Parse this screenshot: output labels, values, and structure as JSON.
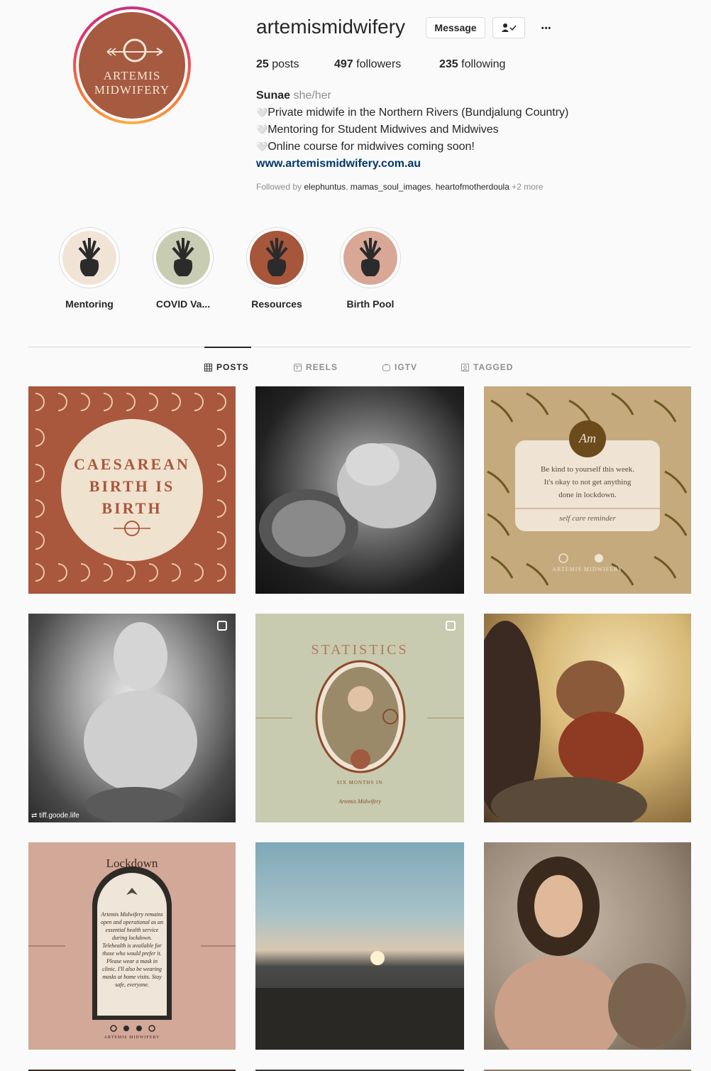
{
  "profile": {
    "username": "artemismidwifery",
    "avatar_line1": "ARTEMIS",
    "avatar_line2": "MIDWIFERY",
    "message_label": "Message",
    "more_label": "•••"
  },
  "stats": {
    "posts_count": "25",
    "posts_label": " posts",
    "followers_count": "497",
    "followers_label": " followers",
    "following_count": "235",
    "following_label": " following"
  },
  "bio": {
    "name": "Sunae",
    "pronouns": "she/her",
    "lines": [
      "Private midwife in the Northern Rivers (Bundjalung Country)",
      "Mentoring for Student Midwives and Midwives",
      "Online course for midwives coming soon!"
    ],
    "bullet": "🤍",
    "website": "www.artemismidwifery.com.au",
    "followed_by_label": "Followed by",
    "followed_users": [
      "elephuntus",
      "mamas_soul_images",
      "heartofmotherdoula"
    ],
    "followed_more": "+2 more"
  },
  "highlights": [
    {
      "label": "Mentoring",
      "bg": "#f1e4d7"
    },
    {
      "label": "COVID Va...",
      "bg": "#c8ccb2"
    },
    {
      "label": "Resources",
      "bg": "#a6563a"
    },
    {
      "label": "Birth Pool",
      "bg": "#d9a796"
    }
  ],
  "tabs": [
    {
      "label": "POSTS",
      "icon": "grid-icon"
    },
    {
      "label": "REELS",
      "icon": "reels-icon"
    },
    {
      "label": "IGTV",
      "icon": "igtv-icon"
    },
    {
      "label": "TAGGED",
      "icon": "tagged-icon"
    }
  ],
  "posts": {
    "p1_line1": "CAESAREAN",
    "p1_line2": "BIRTH IS",
    "p1_line3": "BIRTH",
    "p3_badge": "Am",
    "p3_text1": "Be kind to yourself this week.",
    "p3_text2": "It's okay to not get anything",
    "p3_text3": "done in lockdown.",
    "p3_footer": "self care reminder",
    "p3_brand": "ARTEMIS MIDWIFERY",
    "p4_repost": "tiff.goode.life",
    "p5_title": "STATISTICS",
    "p5_sub": "SIX MONTHS IN",
    "p5_sign": "Artemis Midwifery",
    "p7_title": "Lockdown",
    "p7_body": "Artemis Midwifery remains open and operational as an essential health service during lockdown. Telehealth is available for those who would prefer it. Please wear a mask in clinic. I'll also be wearing masks at home visits. Stay safe, everyone.",
    "p7_brand": "ARTEMIS MIDWIFERY"
  },
  "colors": {
    "accent_link": "#00376b",
    "terracotta": "#a65a3f",
    "sage": "#c8cbb0",
    "blush": "#d2a898",
    "sand": "#c8ad83"
  }
}
